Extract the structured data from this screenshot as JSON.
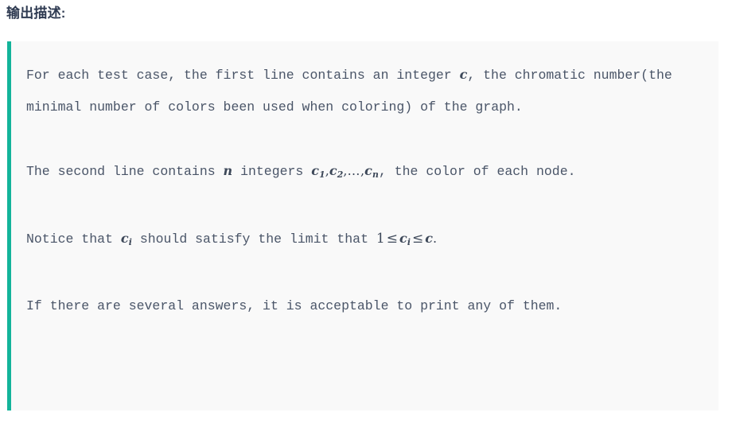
{
  "heading": {
    "label": "输出描述:"
  },
  "colors": {
    "accent_border": "#13b49a",
    "panel_background": "#f9f9f9",
    "page_background": "#ffffff",
    "heading_text": "#2f3b52",
    "body_text": "#4a5568",
    "math_text": "#3d4859"
  },
  "description": {
    "paragraphs": [
      {
        "id": "p1",
        "segments": [
          {
            "type": "text",
            "value": "For each test case, the first line contains an integer "
          },
          {
            "type": "math",
            "value": "c"
          },
          {
            "type": "text",
            "value": ", the chromatic number(the minimal number of colors been used when coloring) of the graph."
          }
        ],
        "plain": "For each test case, the first line contains an integer c, the chromatic number(the minimal number of colors been used when coloring) of the graph."
      },
      {
        "id": "p2",
        "segments": [
          {
            "type": "text",
            "value": "The second line contains "
          },
          {
            "type": "math",
            "value": "n"
          },
          {
            "type": "text",
            "value": " integers "
          },
          {
            "type": "math",
            "value": "c_1, c_2, ..., c_n"
          },
          {
            "type": "text",
            "value": ", the color of each node."
          }
        ],
        "plain": "The second line contains n integers c1, c2, ..., cn, the color of each node."
      },
      {
        "id": "p3",
        "segments": [
          {
            "type": "text",
            "value": "Notice that "
          },
          {
            "type": "math",
            "value": "c_i"
          },
          {
            "type": "text",
            "value": " should satisfy the limit that "
          },
          {
            "type": "math",
            "value": "1 <= c_i <= c"
          },
          {
            "type": "text",
            "value": "."
          }
        ],
        "plain": "Notice that ci should satisfy the limit that 1 <= ci <= c."
      },
      {
        "id": "p4",
        "segments": [
          {
            "type": "text",
            "value": "If there are several answers, it is acceptable to print any of them."
          }
        ],
        "plain": "If there are several answers, it is acceptable to print any of them."
      }
    ],
    "math_tokens": {
      "c": "c",
      "n": "n",
      "c1": "c",
      "c1_sub": "1",
      "c2": "c",
      "c2_sub": "2",
      "cn": "c",
      "cn_sub": "n",
      "ci": "c",
      "ci_sub": "i",
      "ellipsis": "…",
      "comma": ",",
      "one": "1",
      "leq": "≤",
      "period": "."
    },
    "p1_text_a": "For each test case, the first line contains an integer ",
    "p1_text_b": ", the chromatic number(the minimal number of colors been used when",
    "p1_text_c": "coloring) of the graph.",
    "p2_text_a": "The second line contains ",
    "p2_text_b": " integers ",
    "p2_text_c": ", the color of each",
    "p2_text_d": "node.",
    "p3_text_a": "Notice that ",
    "p3_text_b": " should satisfy the limit that ",
    "p4_text_a": "If there are several answers, it is acceptable to print any of",
    "p4_text_b": "them."
  }
}
